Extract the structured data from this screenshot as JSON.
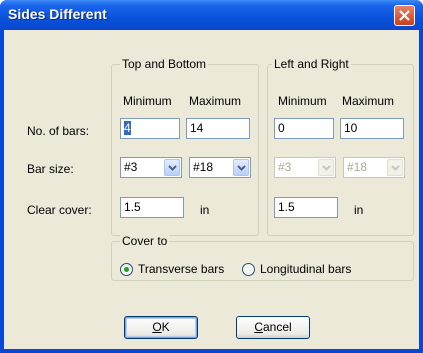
{
  "window": {
    "title": "Sides Different"
  },
  "top_bottom": {
    "legend": "Top and Bottom",
    "min_header": "Minimum",
    "max_header": "Maximum",
    "bars_min": "4",
    "bars_max": "14",
    "size_min": "#3",
    "size_max": "#18",
    "cover": "1.5",
    "cover_unit": "in"
  },
  "left_right": {
    "legend": "Left and Right",
    "min_header": "Minimum",
    "max_header": "Maximum",
    "bars_min": "0",
    "bars_max": "10",
    "size_min": "#3",
    "size_max": "#18",
    "cover": "1.5",
    "cover_unit": "in"
  },
  "row_labels": {
    "no_of_bars": "No. of bars:",
    "bar_size": "Bar size:",
    "clear_cover": "Clear cover:"
  },
  "cover_to": {
    "legend": "Cover to",
    "option_transverse": "Transverse bars",
    "option_longitudinal": "Longitudinal bars",
    "selected": "Transverse bars"
  },
  "buttons": {
    "ok_accel": "O",
    "ok_rest": "K",
    "cancel_accel": "C",
    "cancel_rest": "ancel"
  }
}
